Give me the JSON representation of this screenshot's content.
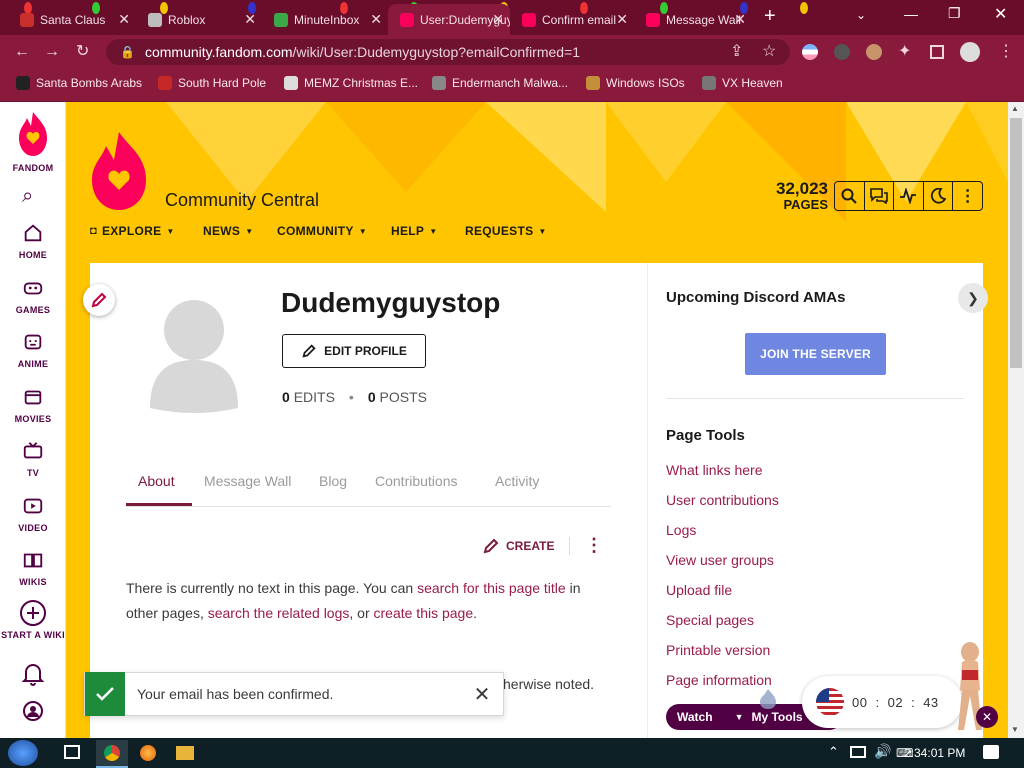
{
  "browser": {
    "tabs": [
      {
        "title": "Santa Claus",
        "color": "#c9302c"
      },
      {
        "title": "Roblox",
        "color": "#bdbdbd"
      },
      {
        "title": "MinuteInbox",
        "color": "#3aa849"
      },
      {
        "title": "User:Dudemyguystop",
        "color": "#fa005a",
        "active": true
      },
      {
        "title": "Confirm email",
        "color": "#fa005a"
      },
      {
        "title": "Message Wall",
        "color": "#fa005a"
      }
    ],
    "new_tab_label": "+",
    "url": "community.fandom.com/wiki/User:Dudemyguystop?emailConfirmed=1",
    "url_host": "community.fandom.com",
    "url_path": "/wiki/User:Dudemyguystop?emailConfirmed=1",
    "bookmarks": [
      {
        "label": "Santa Bombs Arabs",
        "color": "#222"
      },
      {
        "label": "South Hard Pole",
        "color": "#c62828"
      },
      {
        "label": "MEMZ Christmas E...",
        "color": "#ddd"
      },
      {
        "label": "Endermanch Malwa...",
        "color": "#888"
      },
      {
        "label": "Windows ISOs",
        "color": "#c58f3a"
      },
      {
        "label": "VX Heaven",
        "color": "#777"
      }
    ]
  },
  "rail": {
    "brand": "FANDOM",
    "items": [
      {
        "label": "HOME",
        "icon": "home-icon"
      },
      {
        "label": "GAMES",
        "icon": "gamepad-icon"
      },
      {
        "label": "ANIME",
        "icon": "anime-icon"
      },
      {
        "label": "MOVIES",
        "icon": "movie-icon"
      },
      {
        "label": "TV",
        "icon": "tv-icon"
      },
      {
        "label": "VIDEO",
        "icon": "video-icon"
      },
      {
        "label": "WIKIS",
        "icon": "book-icon"
      },
      {
        "label": "START A WIKI",
        "icon": "plus-circle-icon"
      }
    ]
  },
  "wiki": {
    "name": "Community Central",
    "pages_count": "32,023",
    "pages_label": "PAGES",
    "nav": [
      "EXPLORE",
      "NEWS",
      "COMMUNITY",
      "HELP",
      "REQUESTS"
    ]
  },
  "profile": {
    "username": "Dudemyguystop",
    "edit_profile_label": "EDIT PROFILE",
    "edits_count": "0",
    "edits_label": "EDITS",
    "posts_count": "0",
    "posts_label": "POSTS",
    "tabs": [
      "About",
      "Message Wall",
      "Blog",
      "Contributions",
      "Activity"
    ],
    "active_tab": "About",
    "create_label": "CREATE",
    "no_text_1": "There is currently no text in this page. You can ",
    "no_text_link1": "search for this page title",
    "no_text_2": " in other pages, ",
    "no_text_link2": "search the related logs",
    "no_text_3": ", or ",
    "no_text_link3": "create this page",
    "no_text_4": ".",
    "license_tail": "herwise noted."
  },
  "toast": {
    "message": "Your email has been confirmed."
  },
  "sidebar": {
    "ama_title": "Upcoming Discord AMAs",
    "join_label": "JOIN THE SERVER",
    "tools_title": "Page Tools",
    "tools": [
      "What links here",
      "User contributions",
      "Logs",
      "View user groups",
      "Upload file",
      "Special pages",
      "Printable version",
      "Page information"
    ]
  },
  "bottom_bar": {
    "watch_label": "Watch",
    "mytools_label": "My Tools",
    "timer_h": "00",
    "timer_m": "02",
    "timer_s": "43"
  },
  "taskbar": {
    "time": "2:34:01 PM"
  },
  "colors": {
    "browser_frame": "#8a1a3c",
    "fandom_yellow": "#ffc500",
    "link": "#9a1b4d",
    "join_button": "#6f87e0",
    "toast_success": "#1e8b3a"
  }
}
